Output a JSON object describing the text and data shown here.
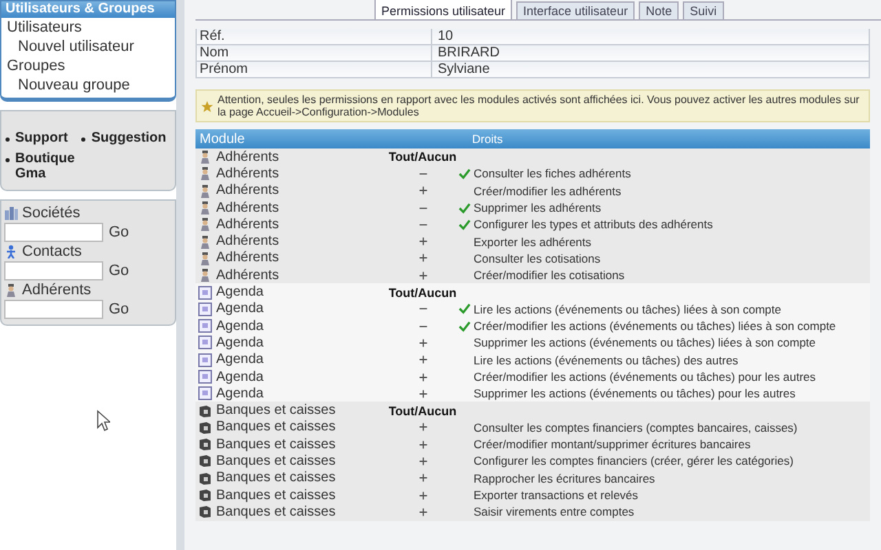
{
  "sidebar": {
    "menu_title": "Utilisateurs & Groupes",
    "menu_items": [
      {
        "label": "Utilisateurs",
        "children": [
          {
            "label": "Nouvel utilisateur"
          }
        ]
      },
      {
        "label": "Groupes",
        "children": [
          {
            "label": "Nouveau groupe"
          }
        ]
      }
    ],
    "links": [
      "Support",
      "Suggestion",
      "Boutique Gma"
    ],
    "searches": [
      {
        "label": "Sociétés",
        "kind": "companies",
        "button": "Go"
      },
      {
        "label": "Contacts",
        "kind": "contacts",
        "button": "Go"
      },
      {
        "label": "Adhérents",
        "kind": "members",
        "button": "Go"
      }
    ]
  },
  "tabs": [
    {
      "label": "Permissions utilisateur",
      "selected": true
    },
    {
      "label": "Interface utilisateur",
      "selected": false
    },
    {
      "label": "Note",
      "selected": false
    },
    {
      "label": "Suivi",
      "selected": false
    }
  ],
  "fields": [
    {
      "label": "Réf.",
      "value": "10"
    },
    {
      "label": "Nom",
      "value": "BRIRARD"
    },
    {
      "label": "Prénom",
      "value": "Sylviane"
    }
  ],
  "warning": "Attention, seules les permissions en rapport avec les modules activés sont affichées ici. Vous pouvez activer les autres modules sur la page Accueil->Configuration->Modules",
  "table": {
    "columns": [
      "Module",
      "Droits"
    ],
    "groups": [
      {
        "module": "Adhérents",
        "kind": "members",
        "header": "Tout/Aucun",
        "rights": [
          {
            "module": "Adhérents",
            "label": "Consulter les fiches adhérents",
            "granted": true
          },
          {
            "module": "Adhérents",
            "label": "Créer/modifier les adhérents",
            "granted": false
          },
          {
            "module": "Adhérents",
            "label": "Supprimer les adhérents",
            "granted": true
          },
          {
            "module": "Adhérents",
            "label": "Configurer les types et attributs des adhérents",
            "granted": true
          },
          {
            "module": "Adhérents",
            "label": "Exporter les adhérents",
            "granted": false
          },
          {
            "module": "Adhérents",
            "label": "Consulter les cotisations",
            "granted": false
          },
          {
            "module": "Adhérents",
            "label": "Créer/modifier les cotisations",
            "granted": false
          }
        ]
      },
      {
        "module": "Agenda",
        "kind": "agenda",
        "header": "Tout/Aucun",
        "rights": [
          {
            "module": "Agenda",
            "label": "Lire les actions (événements ou tâches) liées à son compte",
            "granted": true
          },
          {
            "module": "Agenda",
            "label": "Créer/modifier les actions (événements ou tâches) liées à son compte",
            "granted": true
          },
          {
            "module": "Agenda",
            "label": "Supprimer les actions (événements ou tâches) liées à son compte",
            "granted": false
          },
          {
            "module": "Agenda",
            "label": "Lire les actions (événements ou tâches) des autres",
            "granted": false
          },
          {
            "module": "Agenda",
            "label": "Créer/modifier les actions (événements ou tâches) pour les autres",
            "granted": false
          },
          {
            "module": "Agenda",
            "label": "Supprimer les actions (événements ou tâches) pour les autres",
            "granted": false
          }
        ]
      },
      {
        "module": "Banques et caisses",
        "kind": "bank",
        "header": "Tout/Aucun",
        "rights": [
          {
            "module": "Banques et caisses",
            "label": "Consulter les comptes financiers (comptes bancaires, caisses)",
            "granted": false
          },
          {
            "module": "Banques et caisses",
            "label": "Créer/modifier montant/supprimer écritures bancaires",
            "granted": false
          },
          {
            "module": "Banques et caisses",
            "label": "Configurer les comptes financiers (créer, gérer les catégories)",
            "granted": false
          },
          {
            "module": "Banques et caisses",
            "label": "Rapprocher les écritures bancaires",
            "granted": false
          },
          {
            "module": "Banques et caisses",
            "label": "Exporter transactions et relevés",
            "granted": false
          },
          {
            "module": "Banques et caisses",
            "label": "Saisir virements entre comptes",
            "granted": false
          }
        ]
      }
    ]
  }
}
